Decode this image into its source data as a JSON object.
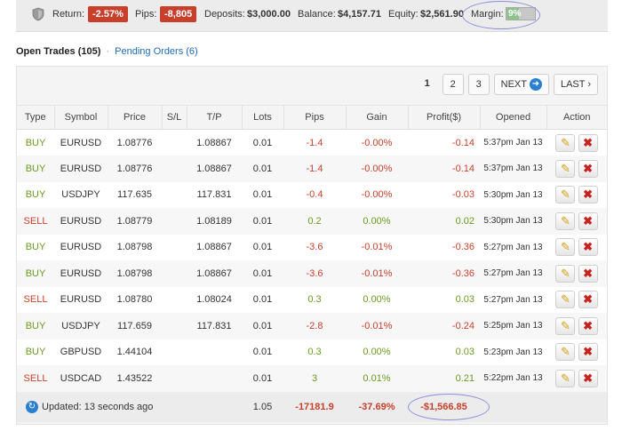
{
  "stats": {
    "return_label": "Return:",
    "return_value": "-2.57%",
    "pips_label": "Pips:",
    "pips_value": "-8,805",
    "deposits_label": "Deposits:",
    "deposits_value": "$3,000.00",
    "balance_label": "Balance:",
    "balance_value": "$4,157.71",
    "equity_label": "Equity:",
    "equity_value": "$2,561.90",
    "margin_label": "Margin:",
    "margin_value": "9%"
  },
  "tabs": {
    "open_trades": "Open Trades (105)",
    "separator": "·",
    "pending_orders": "Pending Orders (6)"
  },
  "pagination": {
    "pages": [
      "1",
      "2",
      "3"
    ],
    "current": "1",
    "next": "NEXT",
    "last": "LAST ›"
  },
  "table": {
    "headers": [
      "Type",
      "Symbol",
      "Price",
      "S/L",
      "T/P",
      "Lots",
      "Pips",
      "Gain",
      "Profit($)",
      "Opened",
      "Action"
    ],
    "rows": [
      {
        "type": "BUY",
        "symbol": "EURUSD",
        "price": "1.08776",
        "sl": "",
        "tp": "1.08867",
        "lots": "0.01",
        "pips": "-1.4",
        "gain": "-0.00%",
        "profit": "-0.14",
        "opened": "5:37pm Jan 13"
      },
      {
        "type": "BUY",
        "symbol": "EURUSD",
        "price": "1.08776",
        "sl": "",
        "tp": "1.08867",
        "lots": "0.01",
        "pips": "-1.4",
        "gain": "-0.00%",
        "profit": "-0.14",
        "opened": "5:37pm Jan 13"
      },
      {
        "type": "BUY",
        "symbol": "USDJPY",
        "price": "117.635",
        "sl": "",
        "tp": "117.831",
        "lots": "0.01",
        "pips": "-0.4",
        "gain": "-0.00%",
        "profit": "-0.03",
        "opened": "5:30pm Jan 13"
      },
      {
        "type": "SELL",
        "symbol": "EURUSD",
        "price": "1.08779",
        "sl": "",
        "tp": "1.08189",
        "lots": "0.01",
        "pips": "0.2",
        "gain": "0.00%",
        "profit": "0.02",
        "opened": "5:30pm Jan 13"
      },
      {
        "type": "BUY",
        "symbol": "EURUSD",
        "price": "1.08798",
        "sl": "",
        "tp": "1.08867",
        "lots": "0.01",
        "pips": "-3.6",
        "gain": "-0.01%",
        "profit": "-0.36",
        "opened": "5:27pm Jan 13"
      },
      {
        "type": "BUY",
        "symbol": "EURUSD",
        "price": "1.08798",
        "sl": "",
        "tp": "1.08867",
        "lots": "0.01",
        "pips": "-3.6",
        "gain": "-0.01%",
        "profit": "-0.36",
        "opened": "5:27pm Jan 13"
      },
      {
        "type": "SELL",
        "symbol": "EURUSD",
        "price": "1.08780",
        "sl": "",
        "tp": "1.08024",
        "lots": "0.01",
        "pips": "0.3",
        "gain": "0.00%",
        "profit": "0.03",
        "opened": "5:27pm Jan 13"
      },
      {
        "type": "BUY",
        "symbol": "USDJPY",
        "price": "117.659",
        "sl": "",
        "tp": "117.831",
        "lots": "0.01",
        "pips": "-2.8",
        "gain": "-0.01%",
        "profit": "-0.24",
        "opened": "5:25pm Jan 13"
      },
      {
        "type": "BUY",
        "symbol": "GBPUSD",
        "price": "1.44104",
        "sl": "",
        "tp": "",
        "lots": "0.01",
        "pips": "0.3",
        "gain": "0.00%",
        "profit": "0.03",
        "opened": "5:23pm Jan 13"
      },
      {
        "type": "SELL",
        "symbol": "USDCAD",
        "price": "1.43522",
        "sl": "",
        "tp": "",
        "lots": "0.01",
        "pips": "3",
        "gain": "0.01%",
        "profit": "0.21",
        "opened": "5:22pm Jan 13"
      }
    ]
  },
  "footer": {
    "updated": "Updated: 13 seconds ago",
    "lots_total": "1.05",
    "pips_total": "-17181.9",
    "gain_total": "-37.69%",
    "profit_total": "-$1,566.85"
  },
  "icons": {
    "shield": "shield-icon",
    "next_arrow": "arrow-right-icon",
    "refresh": "refresh-icon",
    "edit": "pencil-icon",
    "close": "close-icon"
  },
  "colors": {
    "negative_badge": "#c8402b",
    "buy": "#6b9b1e",
    "sell": "#c8402b",
    "link": "#1e6bb8",
    "annotation_circle": "#8b8fd8"
  }
}
